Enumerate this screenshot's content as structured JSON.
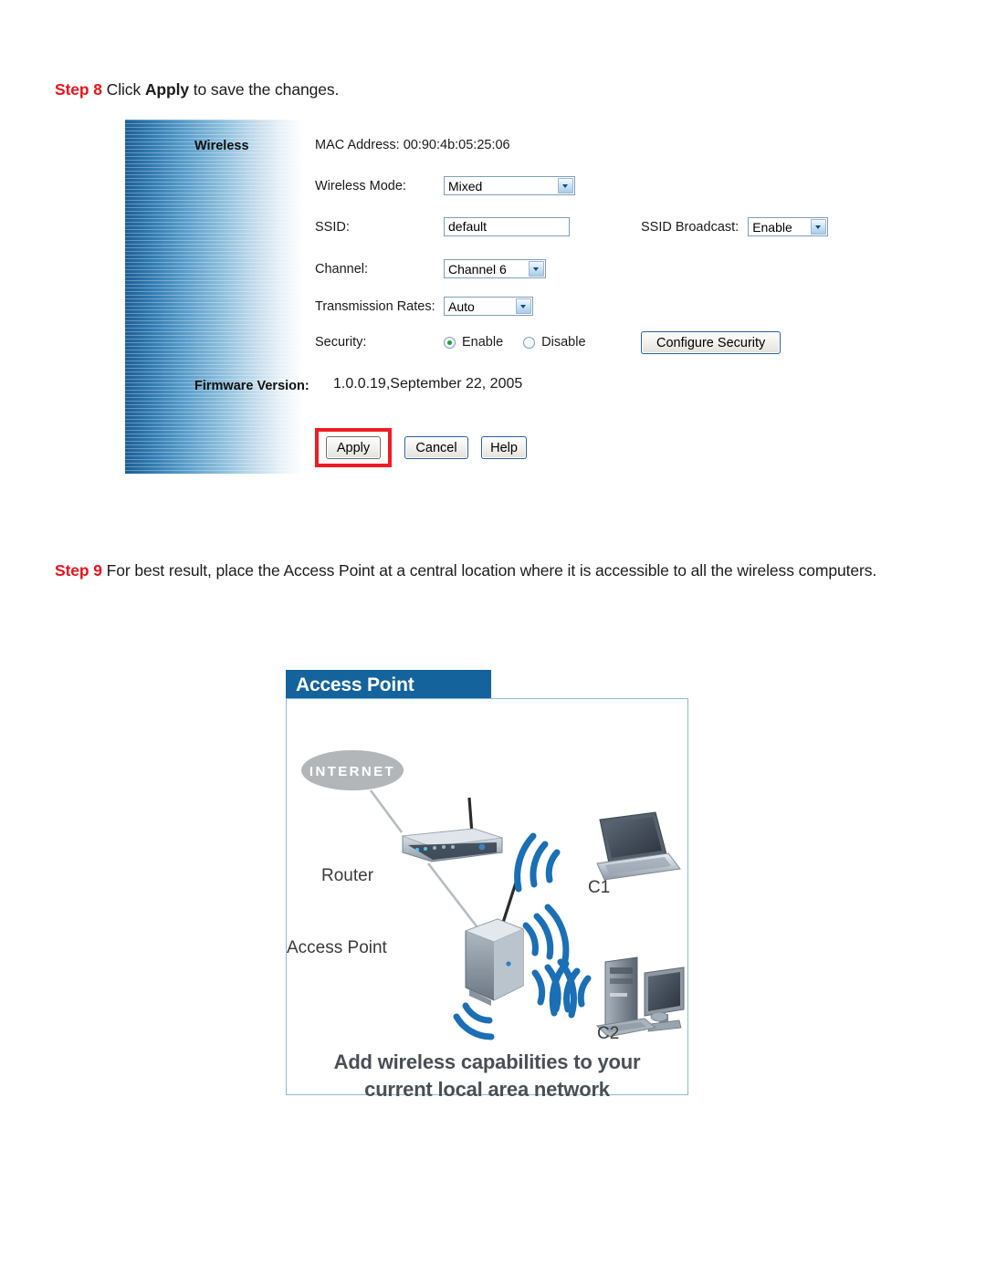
{
  "step8": {
    "label": "Step 8",
    "text_before": " Click ",
    "bold_word": "Apply",
    "text_after": " to save the changes."
  },
  "step9": {
    "label": "Step 9",
    "text": " For best result, place the Access Point at a central location where it is accessible to all the wireless computers."
  },
  "config_panel": {
    "section_heading": "Wireless",
    "firmware_heading": "Firmware Version:",
    "firmware_value": "1.0.0.19,September 22, 2005",
    "mac_address": "MAC Address: 00:90:4b:05:25:06",
    "fields": {
      "wireless_mode": {
        "label": "Wireless Mode:",
        "value": "Mixed"
      },
      "ssid": {
        "label": "SSID:",
        "value": "default",
        "placeholder": "default"
      },
      "ssid_broadcast": {
        "label": "SSID Broadcast:",
        "value": "Enable"
      },
      "channel": {
        "label": "Channel:",
        "value": "Channel 6"
      },
      "transmission_rates": {
        "label": "Transmission Rates:",
        "value": "Auto"
      },
      "security": {
        "label": "Security:",
        "option_enable": "Enable",
        "option_disable": "Disable",
        "selected": "Enable"
      }
    },
    "buttons": {
      "configure_security": "Configure Security",
      "apply": "Apply",
      "cancel": "Cancel",
      "help": "Help"
    },
    "highlight_color": "#ee1c25",
    "sidebar_color": "#1e5f96"
  },
  "ap_figure": {
    "banner_title": "Access Point",
    "banner_color": "#14639d",
    "internet_label": "INTERNET",
    "router_label": "Router",
    "access_point_label": "Access Point",
    "client1_label": "C1",
    "client2_label": "C2",
    "caption_line1": "Add wireless capabilities to your",
    "caption_line2": "current local area network"
  }
}
